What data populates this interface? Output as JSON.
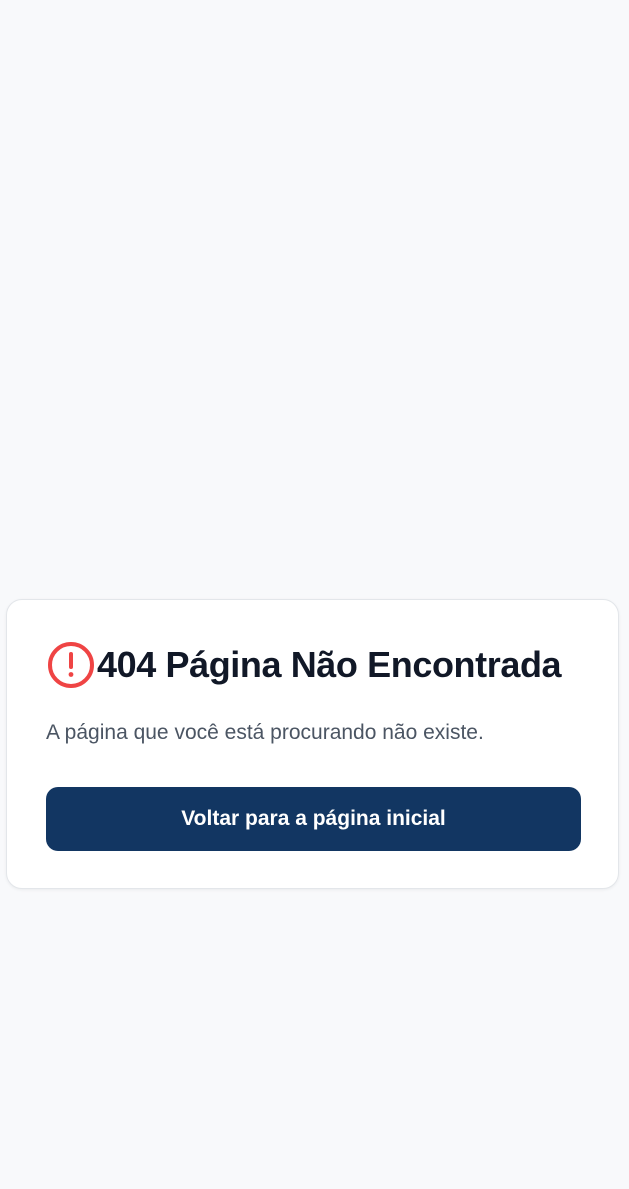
{
  "error_card": {
    "icon": "alert-circle-icon",
    "icon_color": "#ef4444",
    "title": "404 Página Não Encontrada",
    "message": "A página que você está procurando não existe.",
    "home_button_label": "Voltar para a página inicial",
    "button_color": "#123662"
  }
}
